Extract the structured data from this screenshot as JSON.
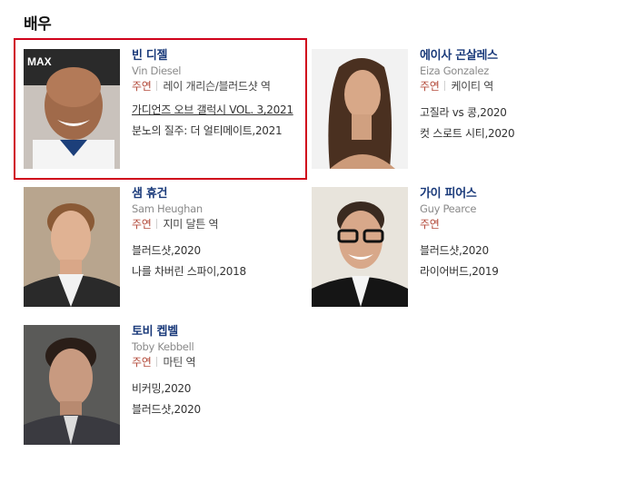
{
  "section": {
    "title": "배우"
  },
  "actors": [
    {
      "korean_name": "빈 디젤",
      "english_name": "Vin Diesel",
      "role_type": "주연",
      "role_desc": "레이 개리슨/블러드샷 역",
      "works": [
        "가디언즈 오브 갤럭시 VOL. 3,2021",
        "분노의 질주: 더 얼티메이트,2021"
      ]
    },
    {
      "korean_name": "에이사 곤살레스",
      "english_name": "Eiza Gonzalez",
      "role_type": "주연",
      "role_desc": "케이티 역",
      "works": [
        "고질라 vs 콩,2020",
        "컷 스로트 시티,2020"
      ]
    },
    {
      "korean_name": "샘 휴건",
      "english_name": "Sam Heughan",
      "role_type": "주연",
      "role_desc": "지미 달튼 역",
      "works": [
        "블러드샷,2020",
        "나를 차버린 스파이,2018"
      ]
    },
    {
      "korean_name": "가이 피어스",
      "english_name": "Guy Pearce",
      "role_type": "주연",
      "role_desc": "",
      "works": [
        "블러드샷,2020",
        "라이어버드,2019"
      ]
    },
    {
      "korean_name": "토비 켑벨",
      "english_name": "Toby Kebbell",
      "role_type": "주연",
      "role_desc": "마틴 역",
      "works": [
        "비커밍,2020",
        "블러드샷,2020"
      ]
    }
  ],
  "colors": {
    "highlight_border": "#d0021b",
    "name_link": "#1a3a7a",
    "role_type": "#b34a3a"
  }
}
